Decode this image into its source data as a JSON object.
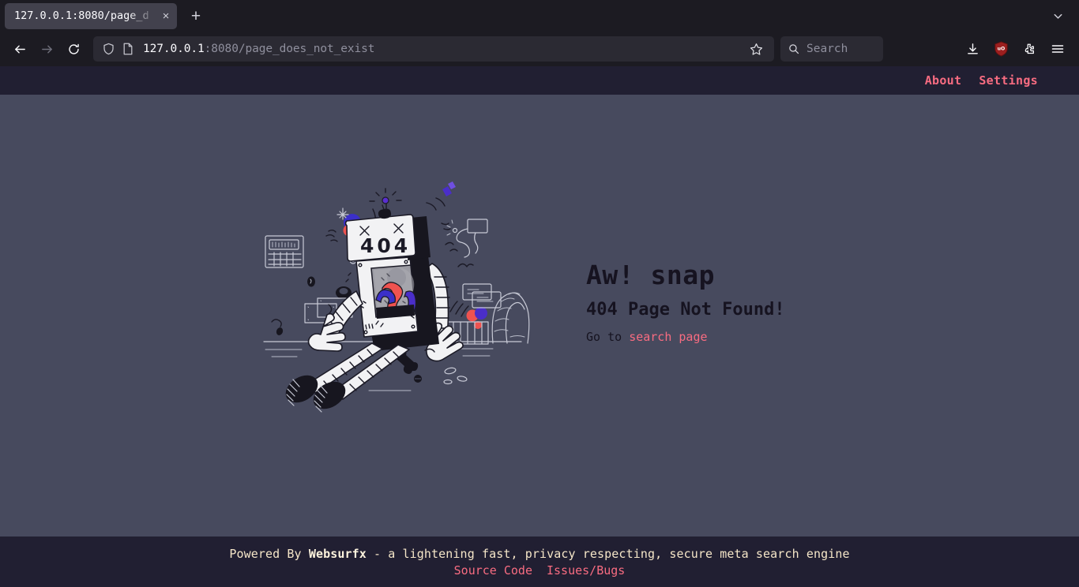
{
  "browser": {
    "tab": {
      "title": "127.0.0.1:8080/page_d",
      "close_label": "×"
    },
    "new_tab_label": "+",
    "url_bar": {
      "host": "127.0.0.1",
      "path": ":8080/page_does_not_exist",
      "full_url": "127.0.0.1:8080/page_does_not_exist"
    },
    "search_box": {
      "placeholder": "Search"
    },
    "ublock_badge": "uO"
  },
  "site": {
    "nav": [
      {
        "label": "About"
      },
      {
        "label": "Settings"
      }
    ],
    "error": {
      "heading": "Aw! snap",
      "subheading": "404 Page Not Found!",
      "go_to_prefix": "Go to ",
      "search_link": "search page",
      "illustration_code": "404"
    },
    "footer": {
      "tagline_prefix": "Powered By ",
      "brand": "Websurfx",
      "tagline_suffix": " - a lightening fast, privacy respecting, secure meta search engine",
      "links": [
        {
          "label": "Source Code"
        },
        {
          "label": "Issues/Bugs"
        }
      ]
    }
  },
  "colors": {
    "page_bg": "#474a5e",
    "chrome_bg": "#1c1b22",
    "bar_bg": "#211f32",
    "accent_pink": "#f86c81",
    "footer_cream": "#f5e6c8",
    "heading_dark": "#161320"
  }
}
